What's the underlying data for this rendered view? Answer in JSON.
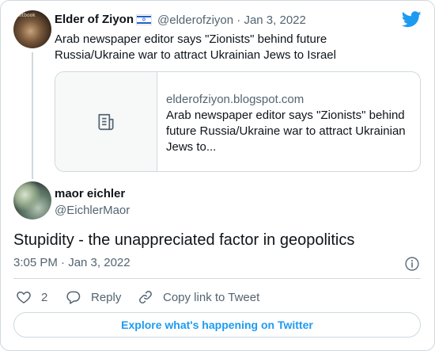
{
  "parent_tweet": {
    "avatar_label": "sitbook",
    "author_name": "Elder of Ziyon",
    "handle": "@elderofziyon",
    "separator": "·",
    "date": "Jan 3, 2022",
    "text": "Arab newspaper editor says \"Zionists\" behind future Russia/Ukraine war to attract Ukrainian Jews to Israel",
    "link_card": {
      "domain": "elderofziyon.blogspot.com",
      "title": "Arab newspaper editor says \"Zionists\" behind future Russia/Ukraine war to attract Ukrainian Jews to..."
    }
  },
  "reply_tweet": {
    "author_name": "maor eichler",
    "handle": "@EichlerMaor",
    "text": "Stupidity - the unappreciated factor in geopolitics",
    "timestamp": "3:05 PM · Jan 3, 2022"
  },
  "actions": {
    "like_count": "2",
    "reply_label": "Reply",
    "copy_label": "Copy link to Tweet"
  },
  "footer": {
    "explore_label": "Explore what's happening on Twitter"
  },
  "colors": {
    "accent": "#1d9bf0",
    "secondary_text": "#536471",
    "border": "#cfd9de"
  }
}
